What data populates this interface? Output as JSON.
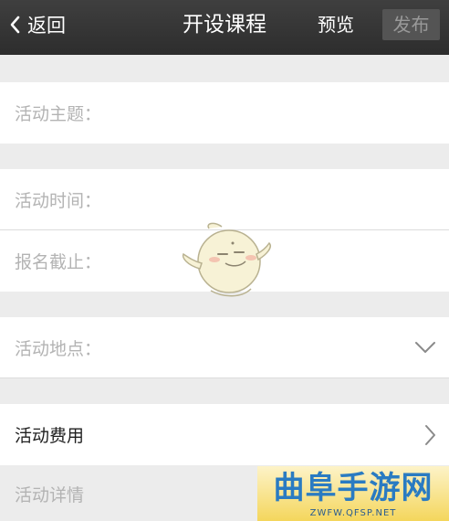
{
  "navbar": {
    "back_label": "返回",
    "title": "开设课程",
    "preview_label": "预览",
    "publish_label": "发布"
  },
  "form": {
    "topic_placeholder": "活动主题：",
    "time_placeholder": "活动时间：",
    "deadline_placeholder": "报名截止：",
    "location_placeholder": "活动地点：",
    "fee_label": "活动费用",
    "details_placeholder": "活动详情"
  },
  "watermark": {
    "title": "曲阜手游网",
    "url": "ZWFW.QFSP.NET"
  },
  "colors": {
    "navbar": "#333333",
    "background": "#ececec",
    "placeholder": "#b3b3b3",
    "watermark_text": "#2a7bc2"
  }
}
